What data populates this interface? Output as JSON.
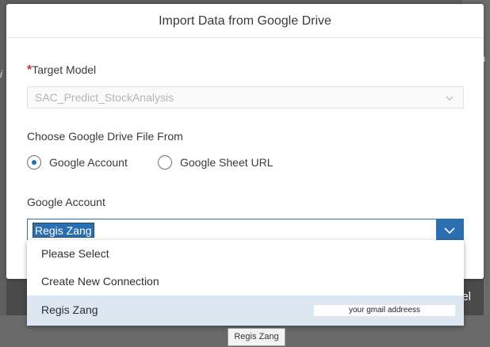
{
  "background": {
    "right_fragment": "n",
    "left_fragment": "i",
    "cancel_fragment": "el"
  },
  "dialog": {
    "title": "Import Data from Google Drive",
    "target_model": {
      "required_mark": "*",
      "label": "Target Model",
      "value": "SAC_Predict_StockAnalysis"
    },
    "source": {
      "label": "Choose Google Drive File From",
      "options": [
        {
          "label": "Google Account",
          "checked": true
        },
        {
          "label": "Google Sheet URL",
          "checked": false
        }
      ]
    },
    "account": {
      "label": "Google Account",
      "value": "Regis Zang"
    }
  },
  "dropdown": {
    "items": [
      {
        "label": "Please Select"
      },
      {
        "label": "Create New Connection"
      },
      {
        "label": "Regis Zang",
        "email": "your gmail addreess"
      }
    ]
  },
  "tooltip": "Regis Zang",
  "colors": {
    "accent": "#2a6fb0",
    "required": "#c0392b",
    "selected_row": "#dde7f1"
  }
}
